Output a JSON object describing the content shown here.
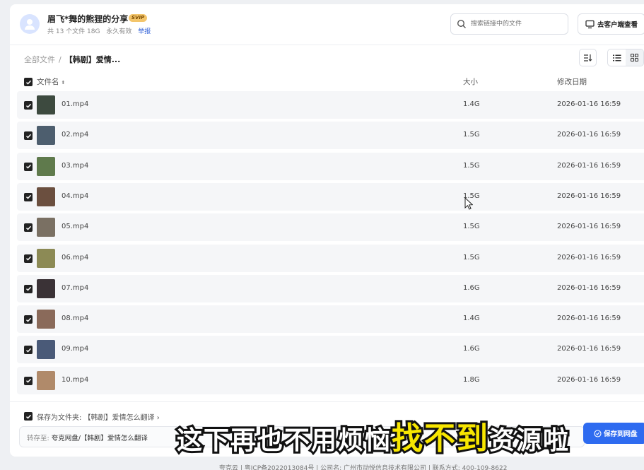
{
  "header": {
    "share_title": "眉飞*舞的熊狸的分享",
    "svip_badge": "SVIP",
    "meta_count": "共 13 个文件 18G",
    "meta_valid": "永久有效",
    "report_link": "举报",
    "search_placeholder": "搜索链接中的文件",
    "client_button": "去客户端查看"
  },
  "breadcrumb": {
    "root": "全部文件",
    "separator": "/",
    "current": "【韩剧】爱情..."
  },
  "table": {
    "columns": {
      "name": "文件名",
      "size": "大小",
      "date": "修改日期"
    },
    "rows": [
      {
        "name": "01.mp4",
        "size": "1.4G",
        "date": "2026-01-16 16:59",
        "thumb": "#3d4a3f"
      },
      {
        "name": "02.mp4",
        "size": "1.5G",
        "date": "2026-01-16 16:59",
        "thumb": "#4d5e6e"
      },
      {
        "name": "03.mp4",
        "size": "1.5G",
        "date": "2026-01-16 16:59",
        "thumb": "#5f7a4c"
      },
      {
        "name": "04.mp4",
        "size": "1.5G",
        "date": "2026-01-16 16:59",
        "thumb": "#6b4f3f"
      },
      {
        "name": "05.mp4",
        "size": "1.5G",
        "date": "2026-01-16 16:59",
        "thumb": "#7a7063"
      },
      {
        "name": "06.mp4",
        "size": "1.5G",
        "date": "2026-01-16 16:59",
        "thumb": "#8c8a55"
      },
      {
        "name": "07.mp4",
        "size": "1.6G",
        "date": "2026-01-16 16:59",
        "thumb": "#3a3236"
      },
      {
        "name": "08.mp4",
        "size": "1.4G",
        "date": "2026-01-16 16:59",
        "thumb": "#8a6a5a"
      },
      {
        "name": "09.mp4",
        "size": "1.6G",
        "date": "2026-01-16 16:59",
        "thumb": "#4a5a78"
      },
      {
        "name": "10.mp4",
        "size": "1.8G",
        "date": "2026-01-16 16:59",
        "thumb": "#b08a6a"
      }
    ]
  },
  "footer": {
    "save_as_folder": "保存为文件夹: 【韩剧】爱情怎么翻译 ›",
    "transfer_label": "转存至:",
    "transfer_path": "夸克网盘/【韩剧】爱情怎么翻译",
    "save_button": "保存到网盘"
  },
  "caption": {
    "part1": "这下再也不用烦恼",
    "highlight": "找不到",
    "part2": "资源啦"
  },
  "page_footer": "夸克云 | 粤ICP备2022013084号 | 公司名: 广州市动悦信息技术有限公司 | 联系方式: 400-109-8622"
}
